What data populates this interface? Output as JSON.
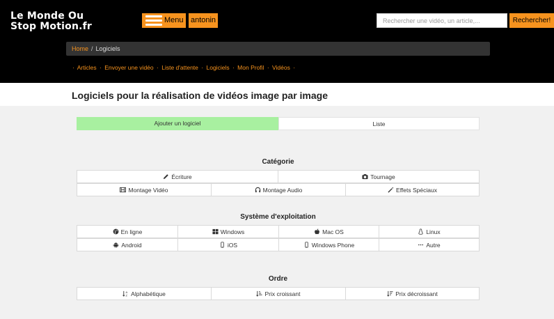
{
  "header": {
    "logo_line1": "Le Monde Ou",
    "logo_line2": "Stop Motion.fr",
    "menu_label": "Menu",
    "user_label": "antonin",
    "search_placeholder": "Rechercher une vidéo, un article,...",
    "search_button": "Rechercher!"
  },
  "breadcrumb": {
    "home": "Home",
    "separator": "/",
    "current": "Logiciels"
  },
  "nav": {
    "items": [
      "Articles",
      "Envoyer une vidéo",
      "Liste d'attente",
      "Logiciels",
      "Mon Profil",
      "Vidéos"
    ],
    "separator": "·"
  },
  "page": {
    "title": "Logiciels pour la réalisation de vidéos image par image"
  },
  "tabs": {
    "add": "Ajouter un logiciel",
    "list": "Liste"
  },
  "categorie": {
    "title": "Catégorie",
    "items": [
      "Écriture",
      "Tournage",
      "Montage Vidéo",
      "Montage Audio",
      "Effets Spéciaux"
    ]
  },
  "systeme": {
    "title": "Système d'exploitation",
    "items": [
      "En ligne",
      "Windows",
      "Mac OS",
      "Linux",
      "Android",
      "iOS",
      "Windows Phone",
      "Autre"
    ]
  },
  "ordre": {
    "title": "Ordre",
    "items": [
      "Alphabétique",
      "Prix croissant",
      "Prix décroissant"
    ]
  },
  "colors": {
    "accent": "#f7931e",
    "header_bg": "#000000",
    "panel_bg": "#f1f1f1",
    "active_tab": "#a8f0a0"
  },
  "icons": {
    "ecriture": "pencil-icon",
    "tournage": "camera-icon",
    "montage_video": "film-icon",
    "montage_audio": "headphones-icon",
    "effets": "magic-wand-icon",
    "en_ligne": "globe-icon",
    "windows": "windows-icon",
    "macos": "apple-icon",
    "linux": "linux-icon",
    "android": "android-icon",
    "ios": "phone-icon",
    "windows_phone": "phone-icon",
    "autre": "ellipsis-icon",
    "alpha": "sort-alpha-icon",
    "prix_asc": "sort-amount-asc-icon",
    "prix_desc": "sort-amount-desc-icon"
  }
}
